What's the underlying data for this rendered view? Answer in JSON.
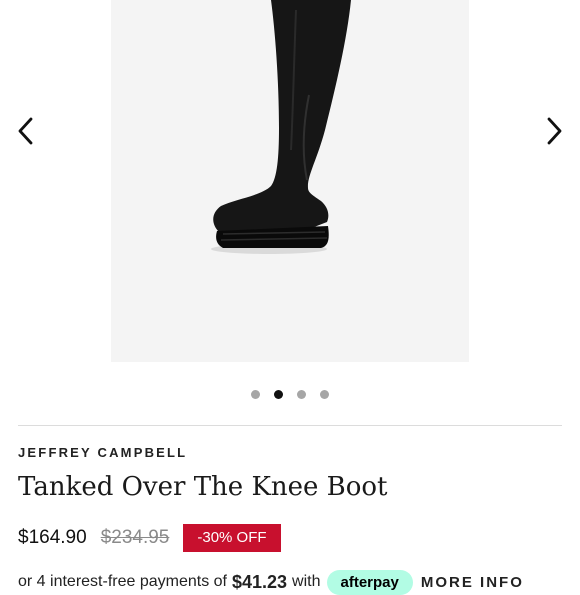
{
  "product": {
    "brand": "JEFFREY CAMPBELL",
    "title": "Tanked Over The Knee Boot",
    "price_current": "$164.90",
    "price_original": "$234.95",
    "discount_badge": "-30% OFF"
  },
  "payment": {
    "prefix": "or 4 interest-free payments of",
    "amount": "$41.23",
    "with_text": "with",
    "provider": "afterpay",
    "more_info": "MORE INFO"
  },
  "carousel": {
    "slide_count": 4,
    "active_slide": 2
  },
  "icons": {
    "prev": "chevron-left-icon",
    "next": "chevron-right-icon"
  },
  "colors": {
    "discount": "#c8102e",
    "afterpay": "#b2fce4",
    "dot_active": "#111111",
    "dot_inactive": "#a6a6a6"
  }
}
